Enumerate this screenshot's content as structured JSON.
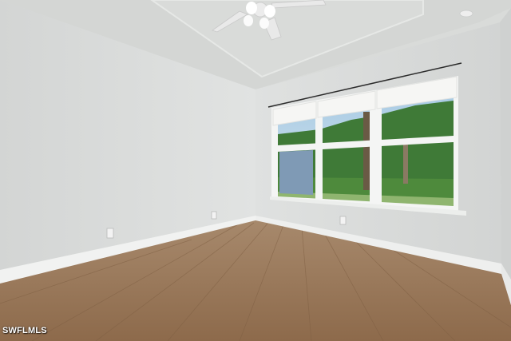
{
  "photo": {
    "watermark": "SWFLMLS",
    "palette": {
      "wall": "#dcdedd",
      "ceiling": "#d6d8d6",
      "floor": "#9a7656",
      "baseboard": "#f1f2f1",
      "window_frame": "#f4f5f4",
      "shade": "#f6f6f4",
      "foliage": "#3f7a37",
      "sky": "#bcd6e8"
    }
  }
}
